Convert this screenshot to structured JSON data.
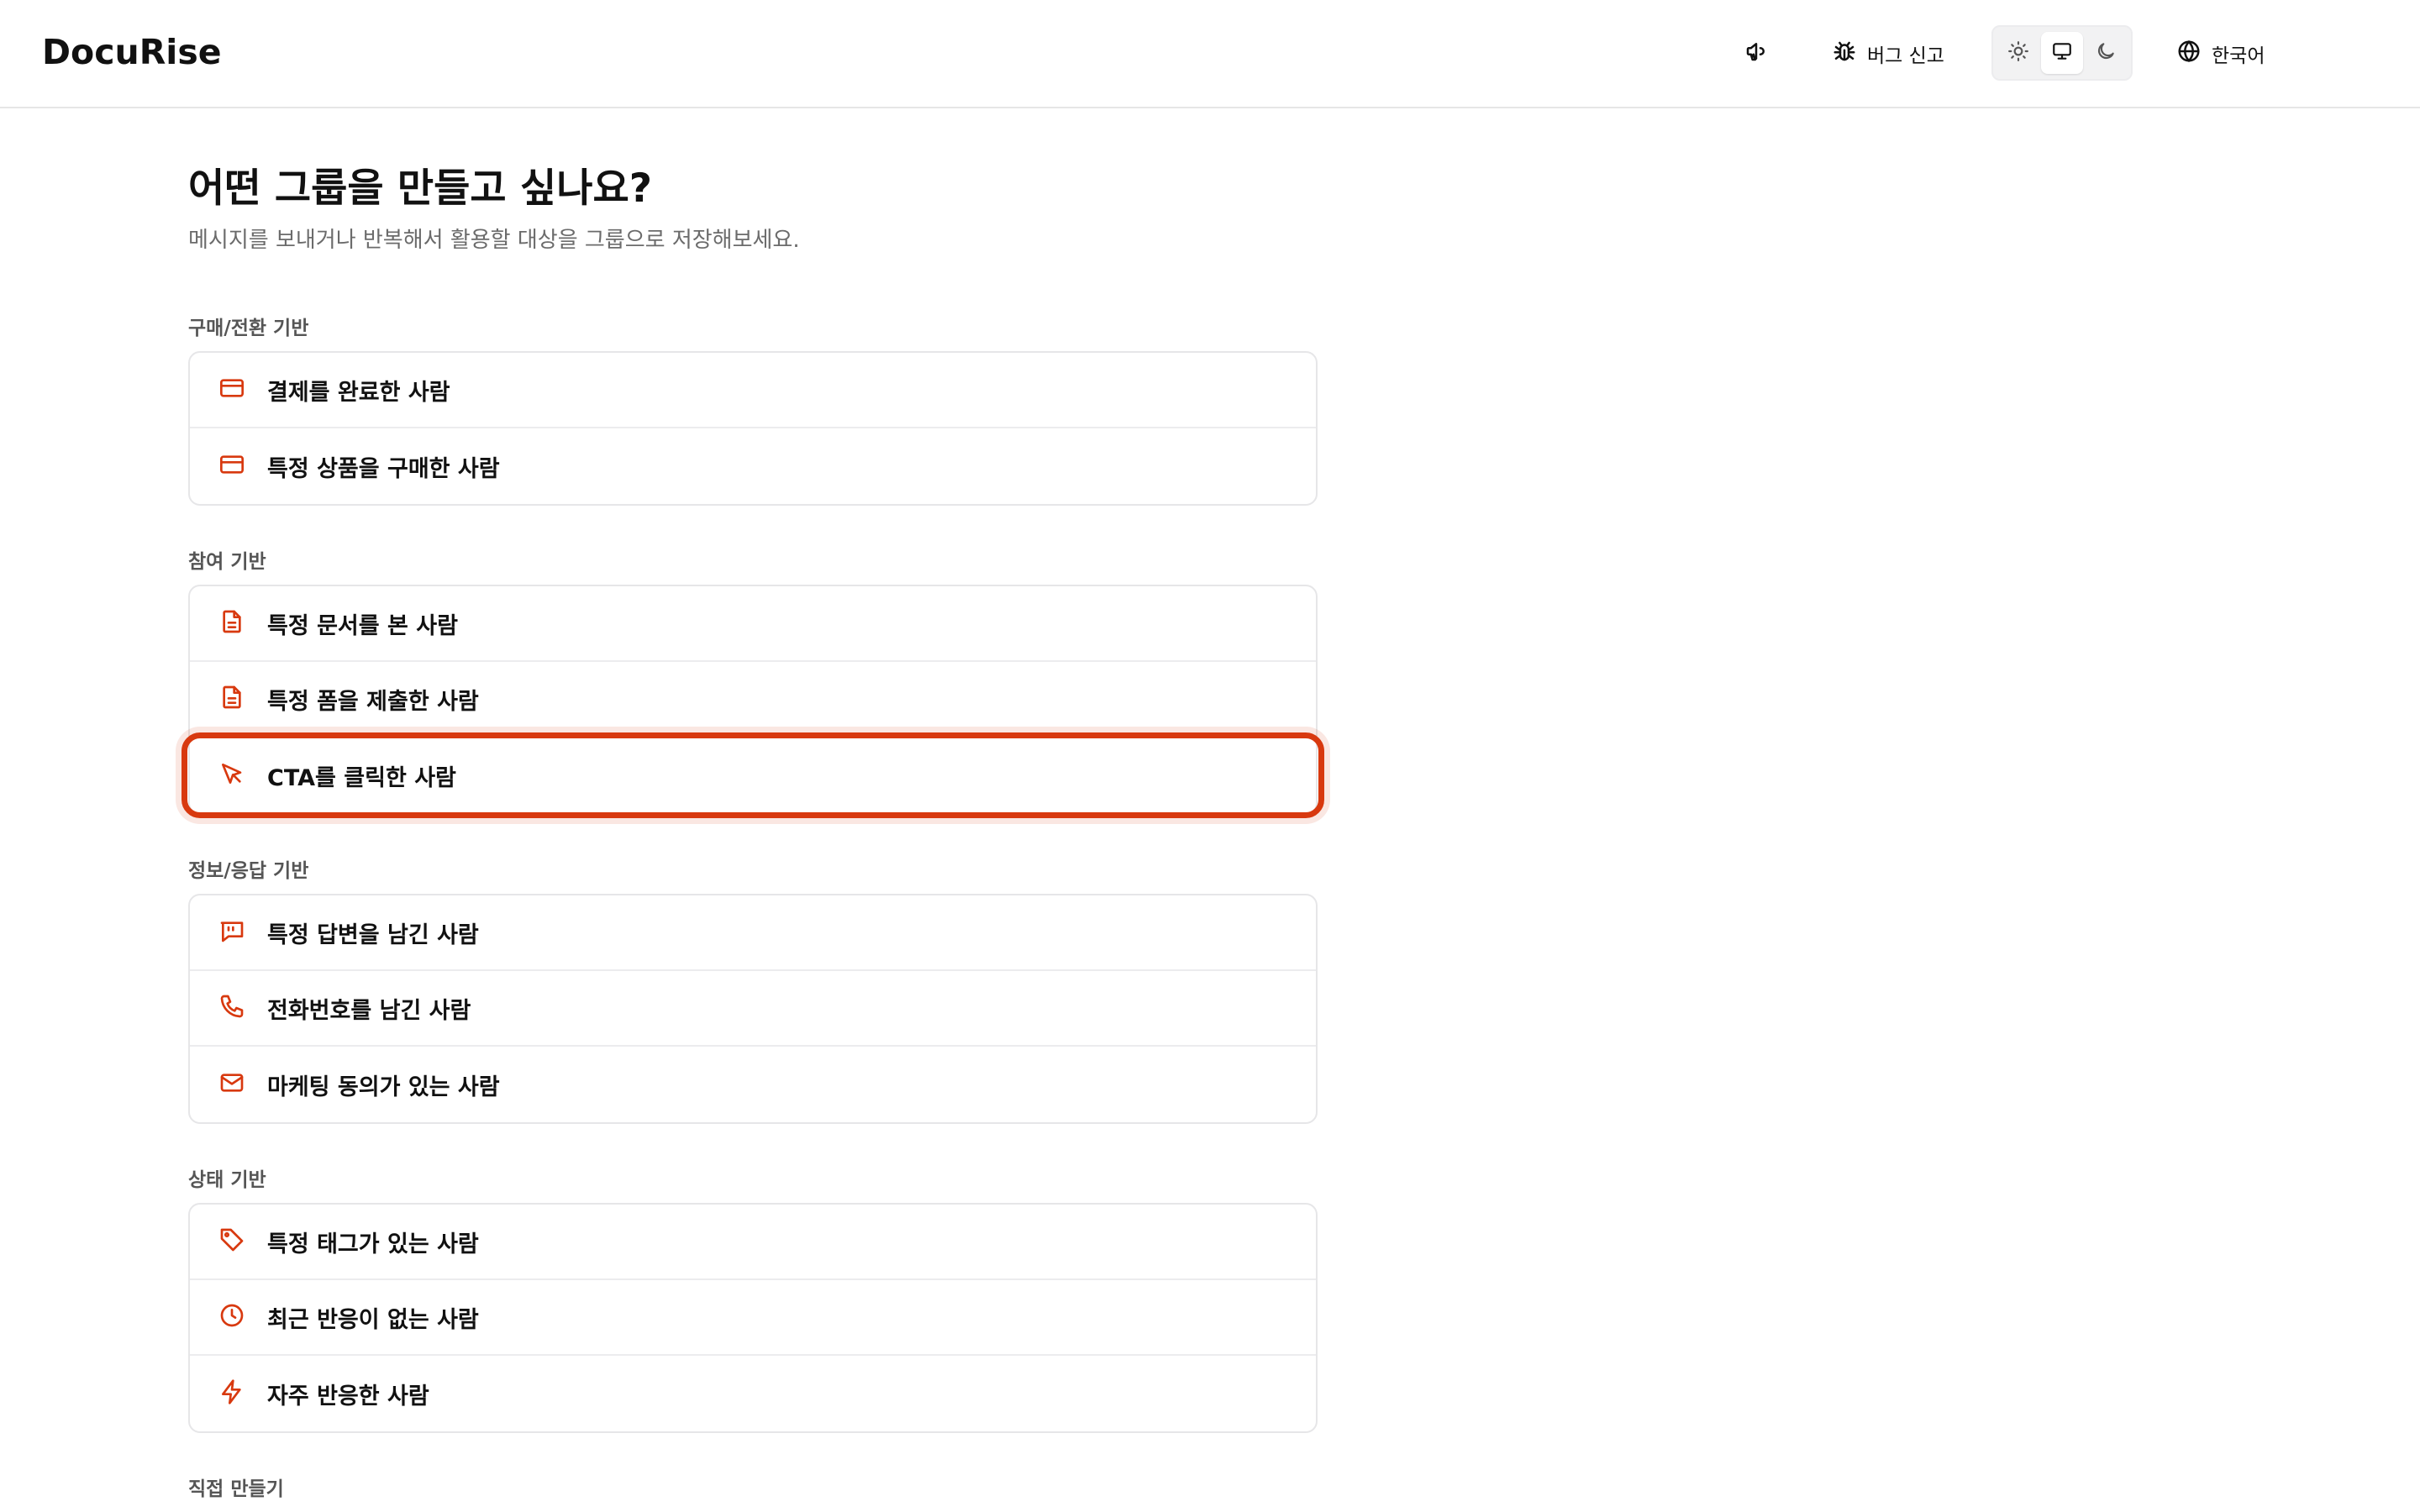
{
  "app": {
    "logo": "DocuRise"
  },
  "header": {
    "bug_report_label": "버그 신고",
    "language_label": "한국어",
    "theme_active": "system"
  },
  "page": {
    "title": "어떤 그룹을 만들고 싶나요?",
    "subtitle": "메시지를 보내거나 반복해서 활용할 대상을 그룹으로 저장해보세요."
  },
  "colors": {
    "accent": "#d8390f",
    "border": "#e6e6e8",
    "muted": "#6b6b6b"
  },
  "sections": [
    {
      "label": "구매/전환 기반",
      "items": [
        {
          "label": "결제를 완료한 사람",
          "icon": "credit-card-icon"
        },
        {
          "label": "특정 상품을 구매한 사람",
          "icon": "credit-card-icon"
        }
      ]
    },
    {
      "label": "참여 기반",
      "items": [
        {
          "label": "특정 문서를 본 사람",
          "icon": "document-icon"
        },
        {
          "label": "특정 폼을 제출한 사람",
          "icon": "document-icon"
        },
        {
          "label": "CTA를 클릭한 사람",
          "icon": "cursor-click-icon",
          "highlighted": true
        }
      ]
    },
    {
      "label": "정보/응답 기반",
      "items": [
        {
          "label": "특정 답변을 남긴 사람",
          "icon": "message-quote-icon"
        },
        {
          "label": "전화번호를 남긴 사람",
          "icon": "phone-icon"
        },
        {
          "label": "마케팅 동의가 있는 사람",
          "icon": "mail-icon"
        }
      ]
    },
    {
      "label": "상태 기반",
      "items": [
        {
          "label": "특정 태그가 있는 사람",
          "icon": "tag-icon"
        },
        {
          "label": "최근 반응이 없는 사람",
          "icon": "clock-icon"
        },
        {
          "label": "자주 반응한 사람",
          "icon": "lightning-icon"
        }
      ]
    },
    {
      "label": "직접 만들기",
      "items": []
    }
  ]
}
